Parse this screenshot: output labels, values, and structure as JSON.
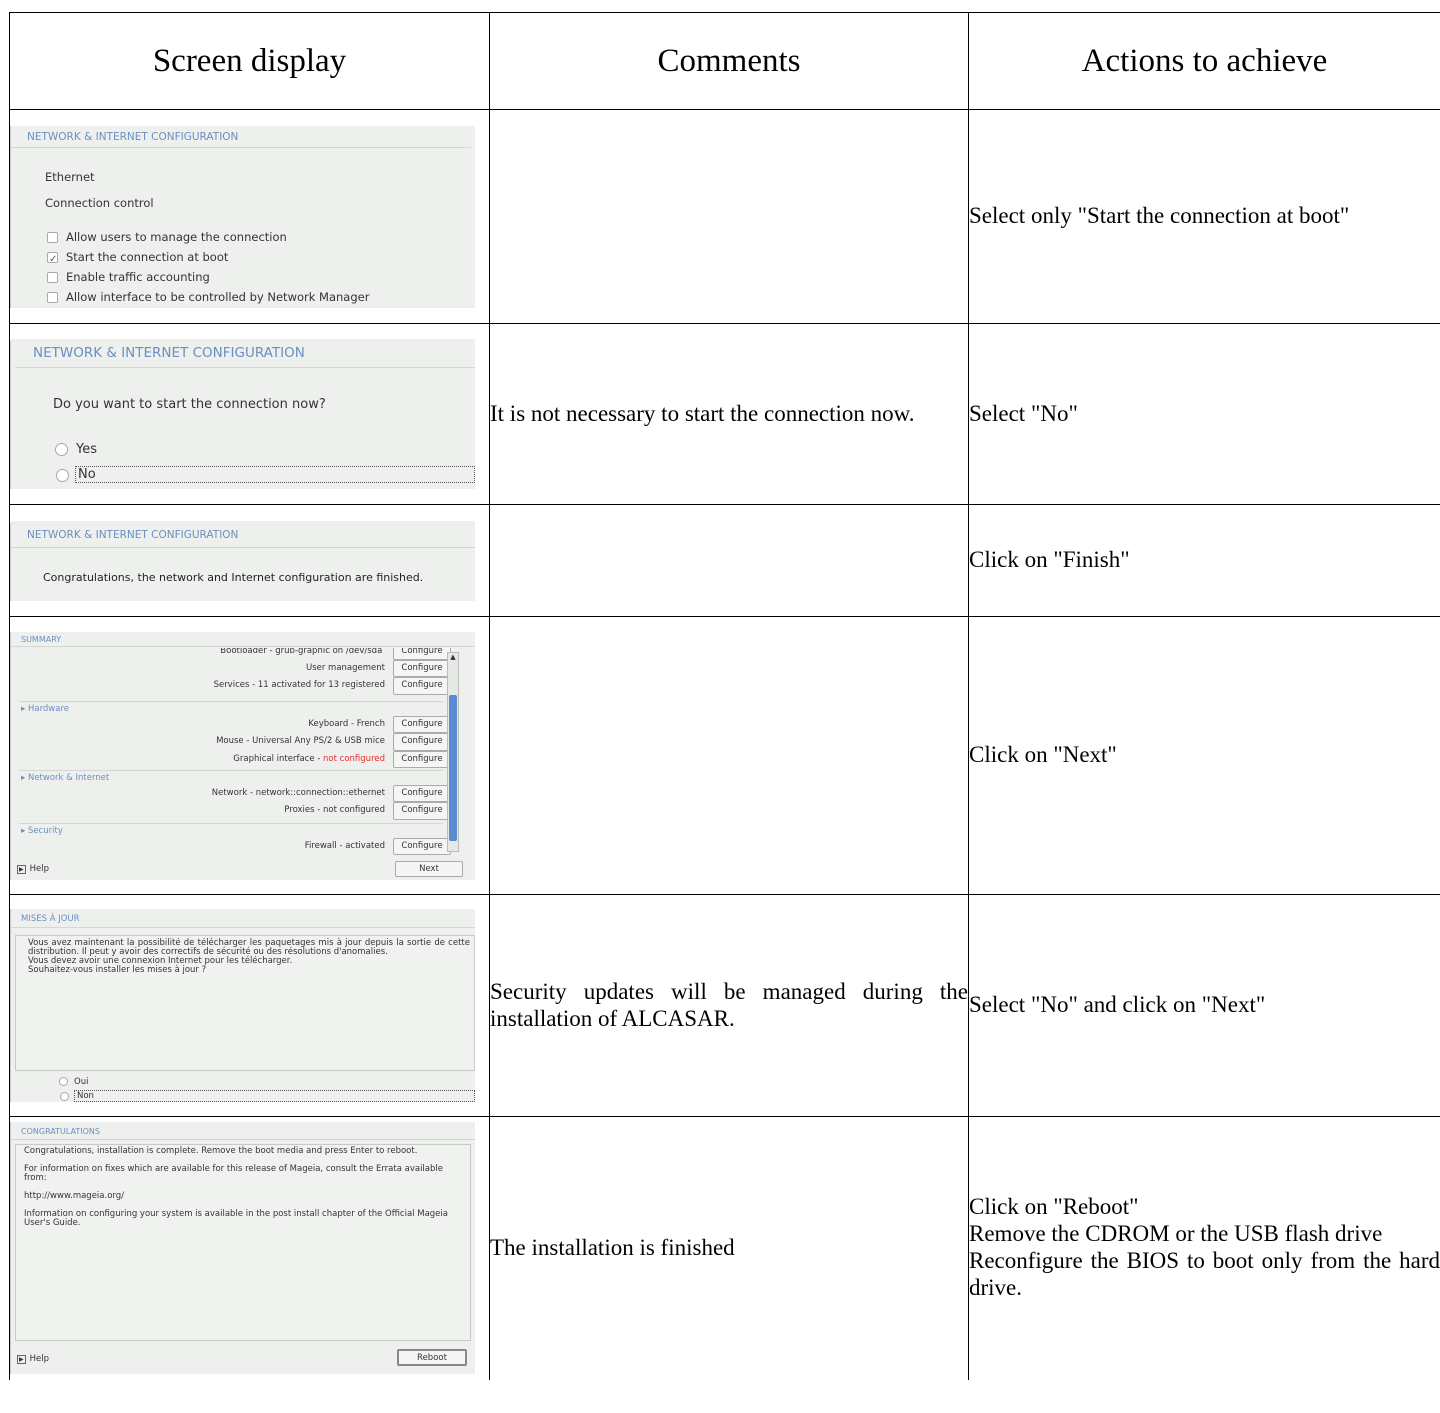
{
  "headers": {
    "screen": "Screen display",
    "comments": "Comments",
    "actions": "Actions to achieve"
  },
  "rows": [
    {
      "shot": {
        "title": "NETWORK & INTERNET CONFIGURATION",
        "section": "Ethernet",
        "subsection": "Connection control",
        "options": [
          {
            "label": "Allow users to manage the connection",
            "checked": false
          },
          {
            "label": "Start the connection at boot",
            "checked": true
          },
          {
            "label": "Enable traffic accounting",
            "checked": false
          },
          {
            "label": "Allow interface to be controlled by Network Manager",
            "checked": false
          }
        ]
      },
      "comment": "",
      "action": "Select only \"Start the connection at boot\""
    },
    {
      "shot": {
        "title": "NETWORK & INTERNET CONFIGURATION",
        "question": "Do you want to start the connection now?",
        "yes": "Yes",
        "no": "No"
      },
      "comment": "It is not necessary to start the connection now.",
      "action": "Select \"No\""
    },
    {
      "shot": {
        "title": "NETWORK & INTERNET CONFIGURATION",
        "message": "Congratulations, the network and Internet configuration are finished."
      },
      "comment": "",
      "action": "Click on \"Finish\""
    },
    {
      "shot": {
        "title": "SUMMARY",
        "cut_line": "Bootloader - grub-graphic on /dev/sda",
        "configure": "Configure",
        "items": [
          {
            "label": "User management"
          },
          {
            "label": "Services - 11 activated for 13 registered"
          }
        ],
        "hardware": "▸ Hardware",
        "hw_items": [
          {
            "label": "Keyboard - French"
          },
          {
            "label": "Mouse - Universal Any PS/2 & USB mice"
          }
        ],
        "graphical_prefix": "Graphical interface - ",
        "graphical_status": "not configured",
        "network": "▸ Network & Internet",
        "net_items": [
          {
            "label": "Network - network::connection::ethernet"
          },
          {
            "label": "Proxies - not configured"
          }
        ],
        "security": "▸ Security",
        "firewall": "Firewall - activated",
        "help": "Help",
        "next": "Next"
      },
      "comment": "",
      "action": "Click on \"Next\""
    },
    {
      "shot": {
        "title": "MISES À JOUR",
        "text": "Vous avez maintenant la possibilité de télécharger les paquetages mis à jour depuis la sortie de cette distribution. Il peut y avoir des correctifs de sécurité ou des résolutions d'anomalies.\nVous devez avoir une connexion Internet pour les télécharger.\nSouhaitez-vous installer les mises à jour ?",
        "oui": "Oui",
        "non": "Non"
      },
      "comment": "Security updates will be managed during the installation of ALCASAR.",
      "action": "Select \"No\" and click on \"Next\""
    },
    {
      "shot": {
        "title": "CONGRATULATIONS",
        "p1": "Congratulations, installation is complete. Remove the boot media and press Enter to reboot.",
        "p2": "For information on fixes which are available for this release of Mageia, consult the Errata available from:",
        "p3": "http://www.mageia.org/",
        "p4": "Information on configuring your system is available in the post install chapter of the Official Mageia User's Guide.",
        "help": "Help",
        "reboot": "Reboot"
      },
      "comment": "The installation is finished",
      "action_lines": [
        "Click on \"Reboot\"",
        "Remove the CDROM or the USB flash drive",
        "Reconfigure the BIOS to boot only from the hard drive."
      ]
    }
  ]
}
